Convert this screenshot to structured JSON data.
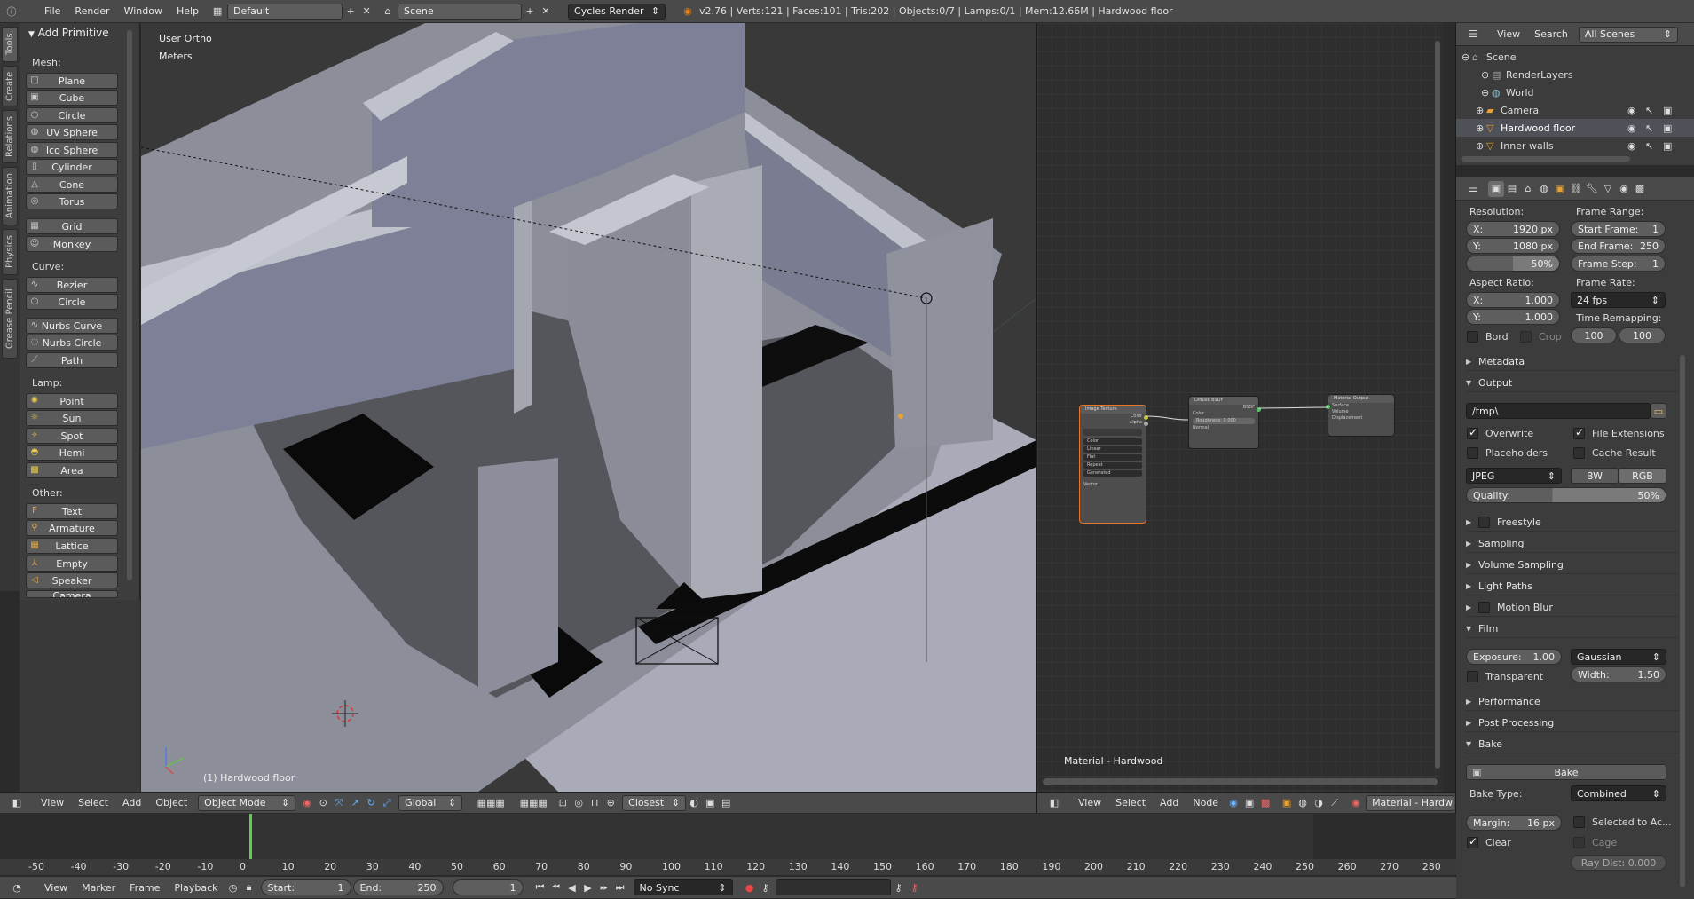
{
  "topbar": {
    "menus": [
      "File",
      "Render",
      "Window",
      "Help"
    ],
    "layout": "Default",
    "scene": "Scene",
    "engine": "Cycles Render",
    "stats": "v2.76 | Verts:121 | Faces:101 | Tris:202 | Objects:0/7 | Lamps:0/1 | Mem:12.66M | Hardwood floor"
  },
  "tabs": [
    "Tools",
    "Create",
    "Relations",
    "Animation",
    "Physics",
    "Grease Pencil"
  ],
  "toolshelf": {
    "title": "Add Primitive",
    "mesh_label": "Mesh:",
    "mesh": [
      "Plane",
      "Cube",
      "Circle",
      "UV Sphere",
      "Ico Sphere",
      "Cylinder",
      "Cone",
      "Torus",
      "Grid",
      "Monkey"
    ],
    "curve_label": "Curve:",
    "curve": [
      "Bezier",
      "Circle",
      "Nurbs Curve",
      "Nurbs Circle",
      "Path"
    ],
    "lamp_label": "Lamp:",
    "lamp": [
      "Point",
      "Sun",
      "Spot",
      "Hemi",
      "Area"
    ],
    "other_label": "Other:",
    "other": [
      "Text",
      "Armature",
      "Lattice",
      "Empty",
      "Speaker",
      "Camera"
    ]
  },
  "viewport": {
    "view_name": "User Ortho",
    "units": "Meters",
    "object_label": "(1) Hardwood floor",
    "header": {
      "menus": [
        "View",
        "Select",
        "Add",
        "Object"
      ],
      "mode": "Object Mode",
      "orientation": "Global",
      "snap": "Closest"
    }
  },
  "nodes": {
    "material_label": "Material - Hardwood",
    "header_menus": [
      "View",
      "Select",
      "Add",
      "Node"
    ],
    "material_field": "Material - Hardw",
    "image_texture": {
      "title": "Image Texture",
      "out1": "Color",
      "out2": "Alpha",
      "opts": [
        "Color",
        "Linear",
        "Flat",
        "Repeat",
        "Generated"
      ],
      "in": "Vector"
    },
    "diffuse": {
      "title": "Diffuse BSDF",
      "out": "BSDF",
      "rows": [
        "Color",
        "Roughness: 0.000",
        "Normal"
      ]
    },
    "output": {
      "title": "Material Output",
      "rows": [
        "Surface",
        "Volume",
        "Displacement"
      ]
    }
  },
  "outliner": {
    "menus": [
      "View",
      "Search"
    ],
    "scope": "All Scenes",
    "items": [
      "Scene",
      "RenderLayers",
      "World",
      "Camera",
      "Hardwood floor",
      "Inner walls"
    ]
  },
  "properties": {
    "resolution_label": "Resolution:",
    "res_x": "X:",
    "res_x_val": "1920 px",
    "res_y": "Y:",
    "res_y_val": "1080 px",
    "res_pct": "50%",
    "frame_range_label": "Frame Range:",
    "start_frame": "Start Frame:",
    "start_frame_val": "1",
    "end_frame": "End Frame:",
    "end_frame_val": "250",
    "frame_step": "Frame Step:",
    "frame_step_val": "1",
    "aspect_label": "Aspect Ratio:",
    "asp_x": "X:",
    "asp_x_val": "1.000",
    "asp_y": "Y:",
    "asp_y_val": "1.000",
    "frame_rate_label": "Frame Rate:",
    "fps": "24 fps",
    "remap_label": "Time Remapping:",
    "remap_old": "100",
    "remap_new": "100",
    "bord": "Bord",
    "crop": "Crop",
    "metadata": "Metadata",
    "output": "Output",
    "output_path": "/tmp\\",
    "overwrite": "Overwrite",
    "file_ext": "File Extensions",
    "placeholders": "Placeholders",
    "cache_result": "Cache Result",
    "format": "JPEG",
    "bw": "BW",
    "rgb": "RGB",
    "quality": "Quality:",
    "quality_val": "50%",
    "freestyle": "Freestyle",
    "sampling": "Sampling",
    "volume_sampling": "Volume Sampling",
    "light_paths": "Light Paths",
    "motion_blur": "Motion Blur",
    "film": "Film",
    "exposure": "Exposure:",
    "exposure_val": "1.00",
    "filter": "Gaussian",
    "transparent": "Transparent",
    "width": "Width:",
    "width_val": "1.50",
    "performance": "Performance",
    "post_processing": "Post Processing",
    "bake": "Bake",
    "bake_btn": "Bake",
    "bake_type_label": "Bake Type:",
    "bake_type": "Combined",
    "margin": "Margin:",
    "margin_val": "16 px",
    "selected_to_active": "Selected to Ac...",
    "clear": "Clear",
    "cage": "Cage",
    "ray_dist": "Ray Dist: 0.000"
  },
  "timeline": {
    "ticks": [
      "-50",
      "-40",
      "-30",
      "-20",
      "-10",
      "0",
      "10",
      "20",
      "30",
      "40",
      "50",
      "60",
      "70",
      "80",
      "90",
      "100",
      "110",
      "120",
      "130",
      "140",
      "150",
      "160",
      "170",
      "180",
      "190",
      "200",
      "210",
      "220",
      "230",
      "240",
      "250",
      "260",
      "270",
      "280"
    ],
    "menus": [
      "View",
      "Marker",
      "Frame",
      "Playback"
    ],
    "start": "Start:",
    "start_val": "1",
    "end": "End:",
    "end_val": "250",
    "current": "1",
    "sync": "No Sync"
  }
}
